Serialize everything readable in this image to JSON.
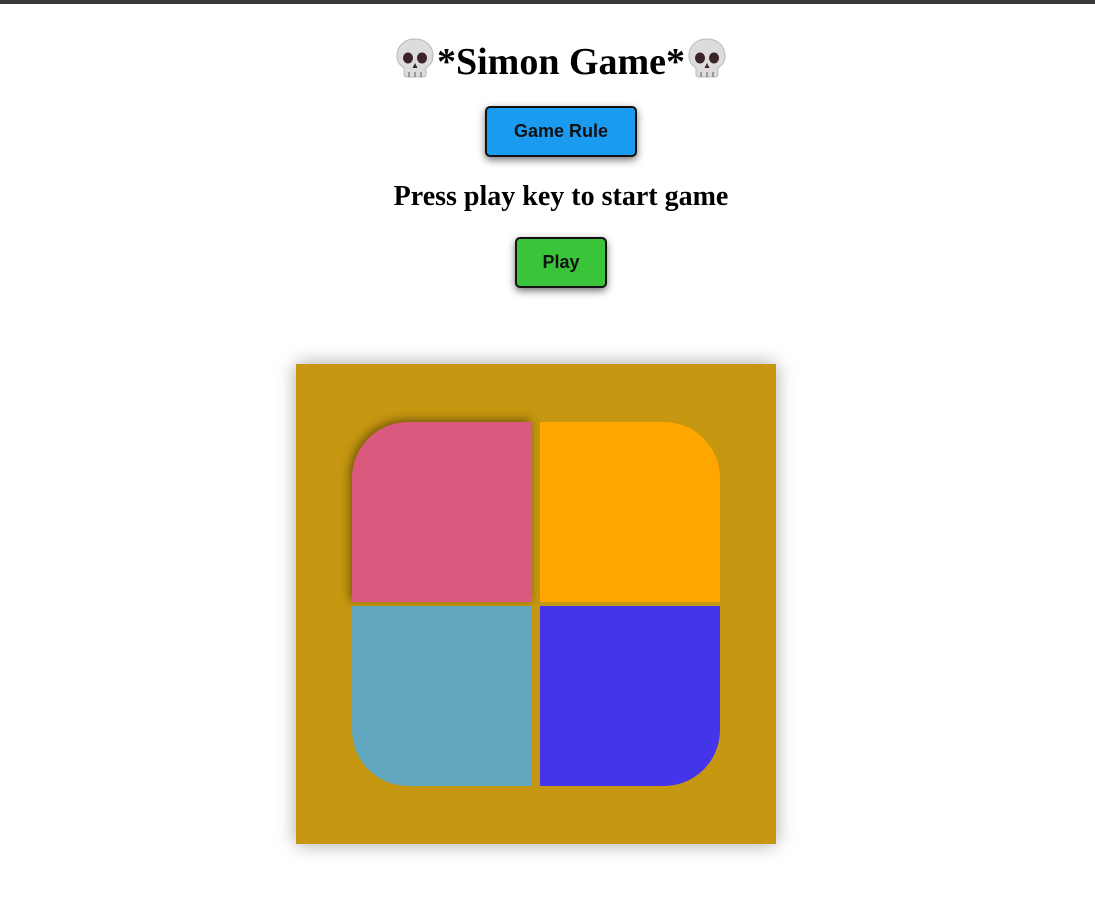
{
  "header": {
    "title": "*Simon Game*",
    "title_icon": "skull-icon"
  },
  "buttons": {
    "rule_label": "Game Rule",
    "play_label": "Play"
  },
  "status": {
    "message": "Press play key to start game"
  },
  "board": {
    "pads": [
      {
        "name": "red",
        "color": "#da597e"
      },
      {
        "name": "yellow",
        "color": "#ffa600"
      },
      {
        "name": "green",
        "color": "#62a9c0"
      },
      {
        "name": "purple",
        "color": "#4535e8"
      }
    ],
    "background_color": "#c69710"
  },
  "colors": {
    "rule_button": "#1a9bf0",
    "play_button": "#3ac43a"
  }
}
